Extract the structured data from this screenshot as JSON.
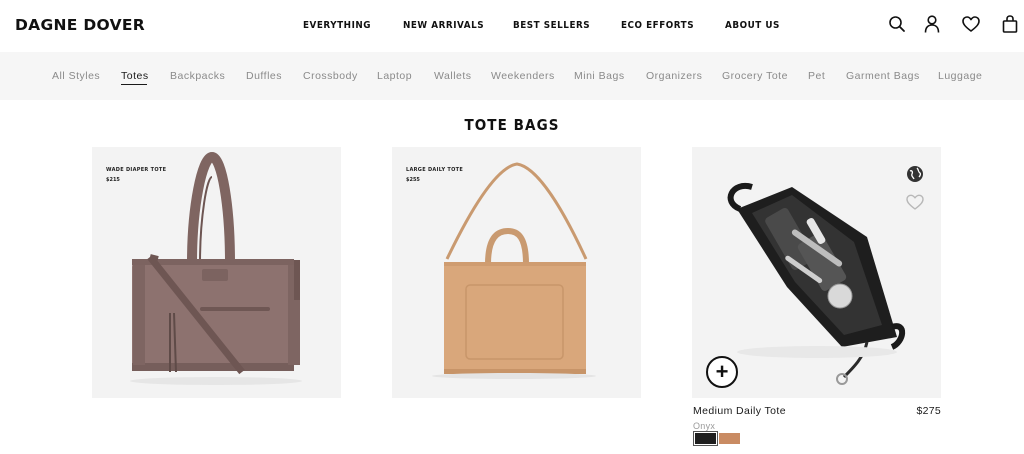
{
  "brand": {
    "logo": "DAGNE DOVER"
  },
  "main_nav": [
    "EVERYTHING",
    "NEW ARRIVALS",
    "BEST SELLERS",
    "ECO EFFORTS",
    "ABOUT US"
  ],
  "header_icons": [
    "search-icon",
    "account-icon",
    "wishlist-heart-icon",
    "cart-bag-icon"
  ],
  "categories": {
    "items": [
      "All Styles",
      "Totes",
      "Backpacks",
      "Duffles",
      "Crossbody",
      "Laptop",
      "Wallets",
      "Weekenders",
      "Mini Bags",
      "Organizers",
      "Grocery Tote",
      "Pet",
      "Garment Bags",
      "Luggage"
    ],
    "active": "Totes"
  },
  "page": {
    "title": "TOTE BAGS"
  },
  "products": [
    {
      "label": "WADE DIAPER TOTE",
      "price": "$215",
      "bag_color": "#8a6f6c"
    },
    {
      "label": "LARGE DAILY TOTE",
      "price": "$255",
      "bag_color": "#d7a57a"
    },
    {
      "name": "Medium Daily Tote",
      "price": "$275",
      "color_name": "Onyx",
      "swatches": [
        "#1f1f1f",
        "#c98b63"
      ],
      "selected_swatch": 0,
      "bag_color": "#1f1f1f"
    }
  ]
}
